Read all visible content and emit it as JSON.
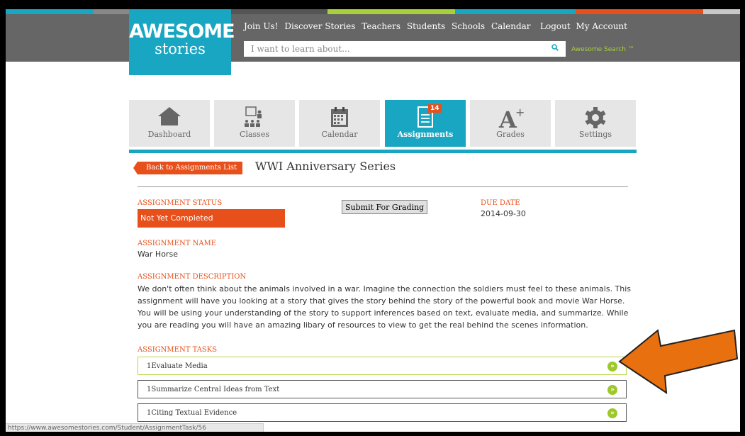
{
  "colors": {
    "brand": "#19a6c2",
    "accent": "#e8501b",
    "go_green": "#9dc82a",
    "arrow": "#e8700f"
  },
  "header": {
    "logo_line1": "AWESOME",
    "logo_line2": "stories",
    "nav": [
      "Join Us!",
      "Discover Stories",
      "Teachers",
      "Students",
      "Schools",
      "Calendar"
    ],
    "nav_right": [
      "Logout",
      "My Account"
    ],
    "search_placeholder": "I want to learn about...",
    "search_link": "Awesome Search ™"
  },
  "tabs": [
    {
      "label": "Dashboard",
      "icon": "home-icon"
    },
    {
      "label": "Classes",
      "icon": "classroom-icon"
    },
    {
      "label": "Calendar",
      "icon": "calendar-icon"
    },
    {
      "label": "Assignments",
      "icon": "document-icon",
      "badge": "14",
      "active": true
    },
    {
      "label": "Grades",
      "icon": "grade-a-plus-icon"
    },
    {
      "label": "Settings",
      "icon": "gear-icon"
    }
  ],
  "assignment": {
    "back_label": "Back to Assignments List",
    "series_title": "WWI Anniversary Series",
    "status_label": "ASSIGNMENT STATUS",
    "status_value": "Not Yet Completed",
    "submit_label": "Submit For Grading",
    "due_label": "DUE DATE",
    "due_value": "2014-09-30",
    "name_label": "ASSIGNMENT NAME",
    "name_value": "War Horse",
    "description_label": "ASSIGNMENT DESCRIPTION",
    "description": "We don't often think about the animals involved in a war. Imagine the connection the soldiers must feel to these animals. This assignment will have you looking at a story that gives the story behind the story of the powerful book and movie War Horse. You will be using your understanding of the story to support inferences based on text, evaluate media, and summarize. While you are reading you will have an amazing libary of resources to view to get the real behind the scenes information.",
    "tasks_label": "ASSIGNMENT TASKS",
    "tasks": [
      {
        "label": "1Evaluate Media"
      },
      {
        "label": "1Summarize Central Ideas from Text"
      },
      {
        "label": "1Citing Textual Evidence"
      }
    ]
  },
  "status_bar": "https://www.awesomestories.com/Student/AssignmentTask/56"
}
